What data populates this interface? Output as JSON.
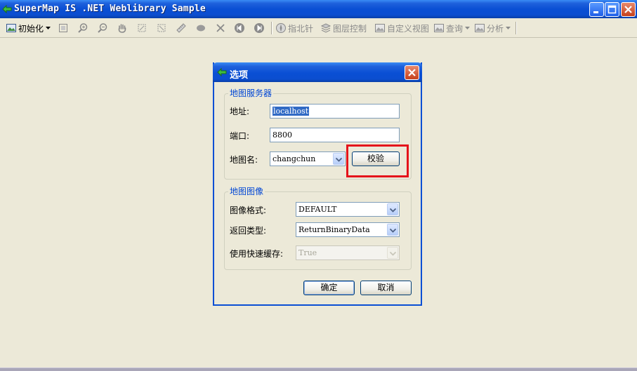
{
  "window": {
    "title": "SuperMap IS .NET Weblibrary Sample"
  },
  "toolbar": {
    "init_label": "初始化",
    "compass_label": "指北针",
    "layer_label": "图层控制",
    "custom_view_label": "自定义视图",
    "query_label": "查询",
    "analysis_label": "分析"
  },
  "dialog": {
    "title": "选项",
    "server_group": {
      "title": "地图服务器",
      "address_label": "地址:",
      "address_value": "localhost",
      "port_label": "端口:",
      "port_value": "8800",
      "mapname_label": "地图名:",
      "mapname_value": "changchun",
      "verify_label": "校验"
    },
    "image_group": {
      "title": "地图图像",
      "format_label": "图像格式:",
      "format_value": "DEFAULT",
      "return_label": "返回类型:",
      "return_value": "ReturnBinaryData",
      "cache_label": "使用快速缓存:",
      "cache_value": "True"
    },
    "ok_label": "确定",
    "cancel_label": "取消"
  },
  "colors": {
    "titlebar_blue": "#0a4fd4",
    "highlight_red": "#e5141b",
    "group_title_blue": "#0046d5"
  }
}
